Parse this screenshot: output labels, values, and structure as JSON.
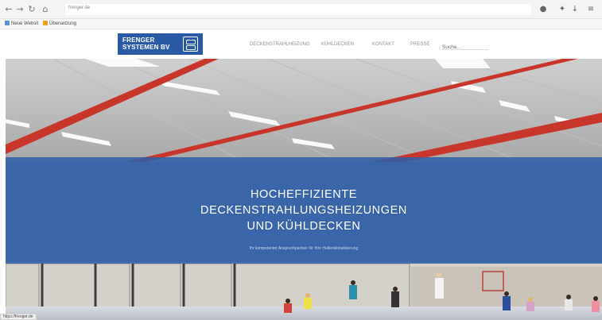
{
  "browser": {
    "back_icon": "back-arrow-icon",
    "forward_icon": "forward-arrow-icon",
    "reload_icon": "reload-icon",
    "home_icon": "home-icon",
    "url": "frenger.de",
    "toolbar_icons": [
      "extension-icon",
      "bookmark-icon",
      "download-icon",
      "menu-icon"
    ]
  },
  "bookmarks": [
    {
      "label": "Neue Websit",
      "color": "#5b8dd6"
    },
    {
      "label": "Übersetzung",
      "color": "#f0a020"
    }
  ],
  "header": {
    "logo_line1": "FRENGER",
    "logo_line2": "SYSTEMEN BV",
    "menu": [
      "DECKENSTRAHLHEIZUNG",
      "KÜHLDECKEN",
      "KONTAKT",
      "PRESSE"
    ],
    "search_placeholder": "Suche..."
  },
  "hero": {
    "title_line1": "HOCHEFFIZIENTE",
    "title_line2": "DECKENSTRAHLUNGSHEIZUNGEN",
    "title_line3": "UND KÜHLDECKEN",
    "subtitle": "Ihr kompetenter Ansprechpartner für Ihre Hallenklimatisierung",
    "band_color": "#2e5ea8"
  },
  "status_bar": "https://frenger.de"
}
